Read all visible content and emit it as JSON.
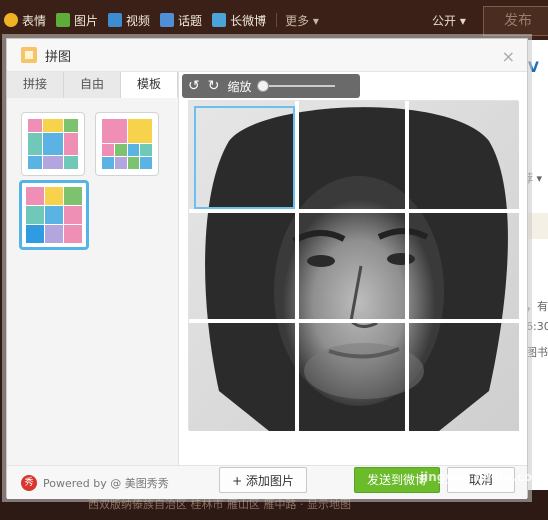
{
  "topbar": {
    "items": [
      {
        "label": "表情",
        "icon": "smile-icon"
      },
      {
        "label": "图片",
        "icon": "picture-icon"
      },
      {
        "label": "视频",
        "icon": "video-icon"
      },
      {
        "label": "话题",
        "icon": "topic-icon"
      },
      {
        "label": "长微博",
        "icon": "long-weibo-icon"
      }
    ],
    "more_label": "更多 ▾",
    "visibility_label": "公开 ▾",
    "publish_label": "发布"
  },
  "background_right": {
    "texts": [
      "V",
      "荐 ▾",
      "，有",
      "6:30",
      "图书"
    ]
  },
  "background_bottom": {
    "text": "西双版纳傣族自治区 桂林市 雁山区 雁中路 · 显示地图"
  },
  "dialog": {
    "title": "拼图",
    "close_label": "×",
    "tabs": [
      {
        "label": "拼接",
        "active": false
      },
      {
        "label": "自由",
        "active": false
      },
      {
        "label": "模板",
        "active": true
      }
    ],
    "toolbar": {
      "rotate_left_icon": "rotate-left-icon",
      "rotate_right_icon": "rotate-right-icon",
      "zoom_label": "缩放",
      "zoom_value": 0
    },
    "footer": {
      "powered_label": "Powered by @ 美图秀秀",
      "logo_text": "秀",
      "add_button_label": "+ 添加图片",
      "send_button_label": "发送到微博",
      "cancel_button_label": "取消"
    }
  },
  "watermark": "jingyan.baidu.com",
  "colors": {
    "accent_blue": "#55b4e6",
    "send_green": "#6cbb2a",
    "template_pink": "#f08fb6",
    "template_yellow": "#f7d34b",
    "template_green": "#7dc36f",
    "template_blue": "#5bb3e4",
    "template_teal": "#6fc8b8",
    "template_purple": "#b3a6df"
  }
}
